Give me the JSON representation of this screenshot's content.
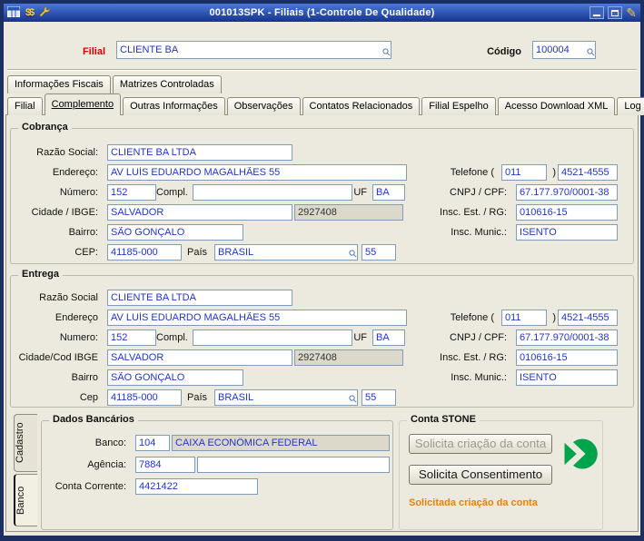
{
  "window": {
    "title": "001013SPK - Filiais (1-Controle De Qualidade)"
  },
  "icons": {
    "edit": "✎",
    "money": "$$"
  },
  "colors": {
    "navy": "#1c2f63",
    "tb1": "#4a79d8",
    "tb2": "#16338e",
    "bg": "#eceadf",
    "fieldborder": "#7f9db9",
    "value": "#2233cc",
    "red": "#dd0000",
    "robg": "#dcd9ca",
    "orange": "#e8820a",
    "green": "#00a44a",
    "tabborder": "#908d7b",
    "disabled": "#9d9a8c"
  },
  "header": {
    "filial_label": "Filial",
    "filial_value": "CLIENTE BA",
    "codigo_label": "Código",
    "codigo_value": "100004"
  },
  "tabs": {
    "top": [
      "Informações Fiscais",
      "Matrizes Controladas"
    ],
    "main": [
      "Filial",
      "Complemento",
      "Outras Informações",
      "Observações",
      "Contatos Relacionados",
      "Filial Espelho",
      "Acesso Download XML",
      "Log"
    ],
    "active": "Complemento"
  },
  "cobranca": {
    "legend": "Cobrança",
    "labels": {
      "razao": "Razão Social:",
      "endereco": "Endereço:",
      "numero": "Número:",
      "compl": "Compl.",
      "uf": "UF",
      "cidade": "Cidade / IBGE:",
      "bairro": "Bairro:",
      "cep": "CEP:",
      "pais": "País",
      "telefone": "Telefone (",
      "telefone_close": ")",
      "cnpj": "CNPJ / CPF:",
      "insc_est": "Insc. Est. / RG:",
      "insc_mun": "Insc. Munic.:"
    },
    "values": {
      "razao": "CLIENTE BA LTDA",
      "endereco": "AV LUÍS EDUARDO MAGALHÃES 55",
      "numero": "152",
      "compl": "",
      "uf": "BA",
      "cidade": "SALVADOR",
      "ibge": "2927408",
      "bairro": "SÃO GONÇALO",
      "cep": "41185-000",
      "pais": "BRASIL",
      "ddi": "55",
      "ddd": "011",
      "fone": "4521-4555",
      "cnpj": "67.177.970/0001-38",
      "insc_est": "010616-15",
      "insc_mun": "ISENTO"
    }
  },
  "entrega": {
    "legend": "Entrega",
    "labels": {
      "razao": "Razão Social",
      "endereco": "Endereço",
      "numero": "Numero:",
      "compl": "Compl.",
      "uf": "UF",
      "cidade": "Cidade/Cod IBGE",
      "bairro": "Bairro",
      "cep": "Cep",
      "pais": "País",
      "telefone": "Telefone (",
      "telefone_close": ")",
      "cnpj": "CNPJ / CPF:",
      "insc_est": "Insc. Est. / RG:",
      "insc_mun": "Insc. Munic.:"
    },
    "values": {
      "razao": "CLIENTE BA LTDA",
      "endereco": "AV LUÍS EDUARDO MAGALHÃES 55",
      "numero": "152",
      "compl": "",
      "uf": "BA",
      "cidade": "SALVADOR",
      "ibge": "2927408",
      "bairro": "SÃO GONÇALO",
      "cep": "41185-000",
      "pais": "BRASIL",
      "ddi": "55",
      "ddd": "011",
      "fone": "4521-4555",
      "cnpj": "67.177.970/0001-38",
      "insc_est": "010616-15",
      "insc_mun": "ISENTO"
    }
  },
  "bottom": {
    "side_tabs": [
      "Cadastro",
      "Banco"
    ],
    "dados": {
      "legend": "Dados Bancários",
      "banco_label": "Banco:",
      "banco_code": "104",
      "banco_nome": "CAIXA ECONÔMICA FEDERAL",
      "agencia_label": "Agência:",
      "agencia": "7884",
      "agencia2": "",
      "conta_label": "Conta Corrente:",
      "conta": "4421422"
    },
    "stone": {
      "legend": "Conta STONE",
      "btn_criacao": "Solicita criação da conta",
      "btn_consentimento": "Solicita Consentimento",
      "status": "Solicitada criação da conta"
    }
  }
}
